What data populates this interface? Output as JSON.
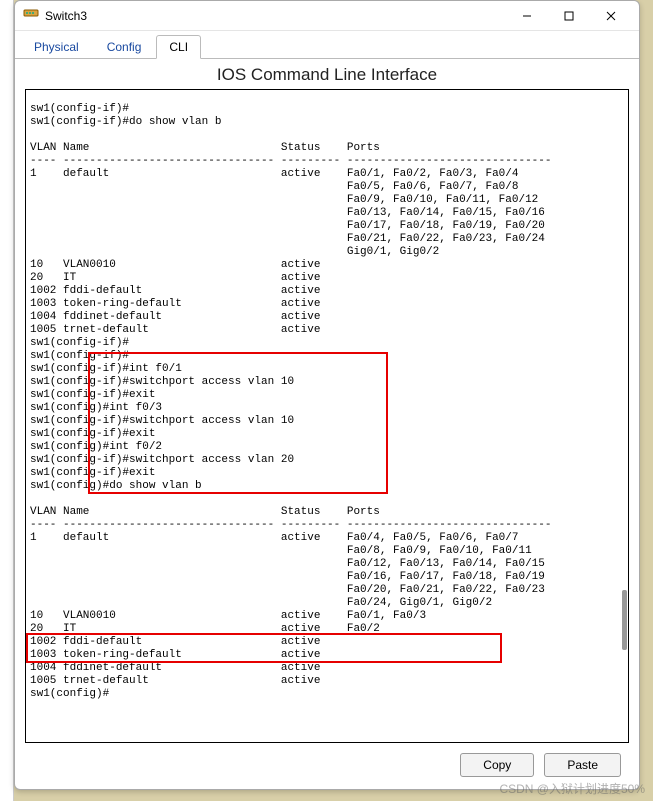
{
  "window": {
    "title": "Switch3",
    "tabs": {
      "physical": "Physical",
      "config": "Config",
      "cli": "CLI"
    },
    "cli_heading": "IOS Command Line Interface",
    "buttons": {
      "copy": "Copy",
      "paste": "Paste"
    }
  },
  "cli_lines": [
    "sw1(config-if)#",
    "sw1(config-if)#do show vlan b",
    "",
    "VLAN Name                             Status    Ports",
    "---- -------------------------------- --------- -------------------------------",
    "1    default                          active    Fa0/1, Fa0/2, Fa0/3, Fa0/4",
    "                                                Fa0/5, Fa0/6, Fa0/7, Fa0/8",
    "                                                Fa0/9, Fa0/10, Fa0/11, Fa0/12",
    "                                                Fa0/13, Fa0/14, Fa0/15, Fa0/16",
    "                                                Fa0/17, Fa0/18, Fa0/19, Fa0/20",
    "                                                Fa0/21, Fa0/22, Fa0/23, Fa0/24",
    "                                                Gig0/1, Gig0/2",
    "10   VLAN0010                         active    ",
    "20   IT                               active    ",
    "1002 fddi-default                     active    ",
    "1003 token-ring-default               active    ",
    "1004 fddinet-default                  active    ",
    "1005 trnet-default                    active    ",
    "sw1(config-if)#",
    "sw1(config-if)#",
    "sw1(config-if)#int f0/1",
    "sw1(config-if)#switchport access vlan 10",
    "sw1(config-if)#exit",
    "sw1(config)#int f0/3",
    "sw1(config-if)#switchport access vlan 10",
    "sw1(config-if)#exit",
    "sw1(config)#int f0/2",
    "sw1(config-if)#switchport access vlan 20",
    "sw1(config-if)#exit",
    "sw1(config)#do show vlan b",
    "",
    "VLAN Name                             Status    Ports",
    "---- -------------------------------- --------- -------------------------------",
    "1    default                          active    Fa0/4, Fa0/5, Fa0/6, Fa0/7",
    "                                                Fa0/8, Fa0/9, Fa0/10, Fa0/11",
    "                                                Fa0/12, Fa0/13, Fa0/14, Fa0/15",
    "                                                Fa0/16, Fa0/17, Fa0/18, Fa0/19",
    "                                                Fa0/20, Fa0/21, Fa0/22, Fa0/23",
    "                                                Fa0/24, Gig0/1, Gig0/2",
    "10   VLAN0010                         active    Fa0/1, Fa0/3",
    "20   IT                               active    Fa0/2",
    "1002 fddi-default                     active    ",
    "1003 token-ring-default               active    ",
    "1004 fddinet-default                  active    ",
    "1005 trnet-default                    active    ",
    "sw1(config)#"
  ],
  "watermark": "CSDN @入狱计划进度50%"
}
